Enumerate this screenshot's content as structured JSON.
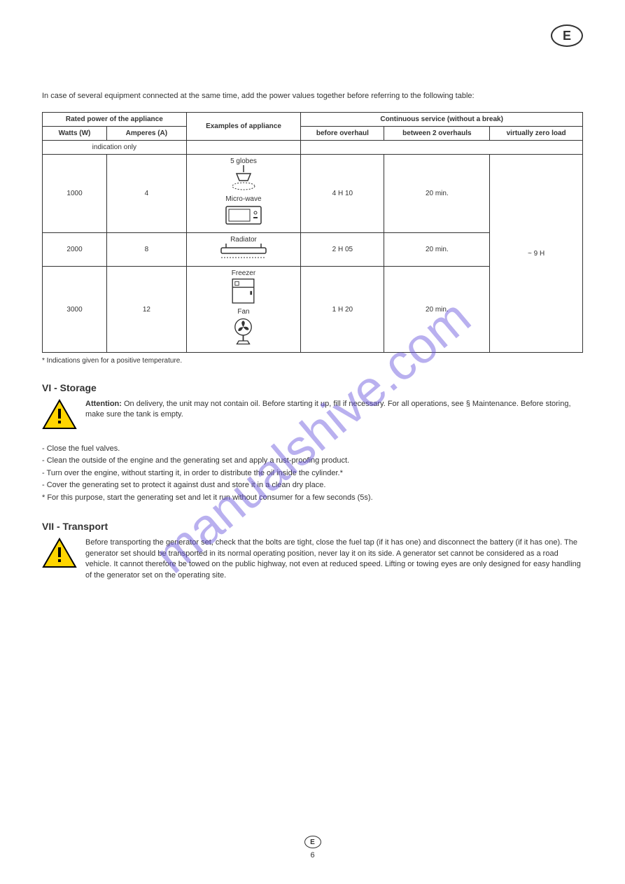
{
  "badge_letter": "E",
  "intro_text": "In case of several equipment connected at the same time, add the power values together before referring to the following table:",
  "table": {
    "headers": {
      "power_col": "Rated power of the appliance",
      "example_col": "Examples of appliance",
      "dc_col": "Continuous service (without a break)",
      "watts": "Watts (W)",
      "amperes": "Amperes (A)",
      "indicative": "indication only",
      "before": "before overhaul",
      "between": "between 2 overhauls",
      "virtually": "virtually zero load"
    },
    "rows": [
      {
        "watts": "1000",
        "amperes": "4",
        "appliance_label1": "5 globes",
        "appliance_label2": "Micro-wave",
        "before": "4 H 10",
        "between": "20 min.",
        "virtually": "~ 9 H",
        "icons": [
          "lamp",
          "microwave"
        ]
      },
      {
        "watts": "2000",
        "amperes": "8",
        "appliance_label1": "Radiator",
        "before": "2 H 05",
        "between": "20 min.",
        "virtually": "",
        "icons": [
          "radiator"
        ]
      },
      {
        "watts": "3000",
        "amperes": "12",
        "appliance_label1": "Freezer",
        "appliance_label2": "Fan",
        "before": "1 H 20",
        "between": "20 min.",
        "virtually": "",
        "icons": [
          "freezer",
          "fan"
        ]
      }
    ],
    "footnote": "* Indications given for a positive temperature."
  },
  "section6": {
    "title": "VI - Storage",
    "warn_label": "Attention:",
    "warn_body": "On delivery, the unit may not contain oil. Before starting it up, fill if necessary. For all operations, see § Maintenance. Before storing, make sure the tank is empty.",
    "items": [
      "- Close the fuel valves.",
      "- Clean the outside of the engine and the generating set and apply a rust-proofing product.",
      "- Turn over the engine, without starting it, in order to distribute the oil inside the cylinder.*",
      "- Cover the generating set to protect it against dust and store it in a clean dry place.",
      "*  For this purpose, start the generating set and let it run without consumer for a few seconds (5s)."
    ]
  },
  "section7": {
    "title": "VII - Transport",
    "warn_body": "Before transporting the generator set, check that the bolts are tight, close the fuel tap (if it has one) and disconnect the battery (if it has one). The generator set should be transported in its normal operating position, never lay it on its side. A generator set cannot be considered as a road vehicle. It cannot therefore be towed on the public highway, not even at reduced speed. Lifting or towing eyes are only designed for easy handling of the generator set on the operating site."
  },
  "footer": {
    "letter": "E",
    "page": "6"
  },
  "watermark": "manualshive.com"
}
